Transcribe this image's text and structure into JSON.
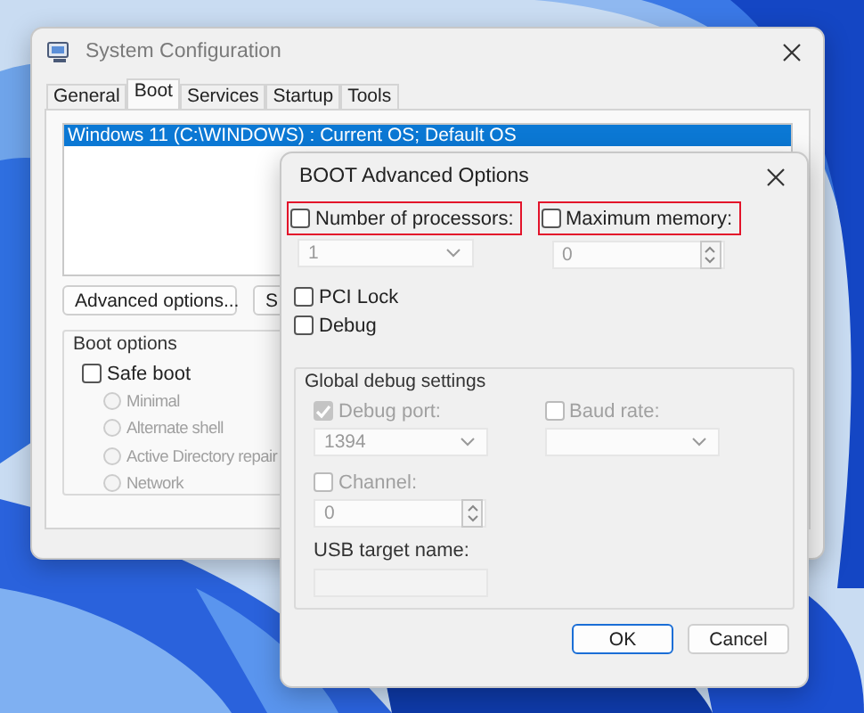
{
  "main_window": {
    "title": "System Configuration",
    "tabs": [
      {
        "label": "General",
        "selected": false
      },
      {
        "label": "Boot",
        "selected": true
      },
      {
        "label": "Services",
        "selected": false
      },
      {
        "label": "Startup",
        "selected": false
      },
      {
        "label": "Tools",
        "selected": false
      }
    ],
    "boot_list": [
      {
        "text": "Windows 11 (C:\\WINDOWS) : Current OS; Default OS",
        "selected": true
      }
    ],
    "buttons": [
      "Advanced options...",
      "S"
    ],
    "boot_options": {
      "title": "Boot options",
      "safe_boot": {
        "label": "Safe boot",
        "checked": false
      },
      "modes": [
        {
          "label": "Minimal",
          "selected": false,
          "disabled": true
        },
        {
          "label": "Alternate shell",
          "selected": false,
          "disabled": true
        },
        {
          "label": "Active Directory repair",
          "selected": false,
          "disabled": true
        },
        {
          "label": "Network",
          "selected": false,
          "disabled": true
        }
      ]
    }
  },
  "dialog": {
    "title": "BOOT Advanced Options",
    "processors": {
      "label": "Number of processors:",
      "checked": false,
      "highlighted": true,
      "value": "1",
      "disabled": true
    },
    "memory": {
      "label": "Maximum memory:",
      "checked": false,
      "highlighted": true,
      "value": "0",
      "disabled": true
    },
    "options": [
      {
        "label": "PCI Lock",
        "checked": false
      },
      {
        "label": "Debug",
        "checked": false
      }
    ],
    "debug_group": {
      "title": "Global debug settings",
      "debug_port": {
        "label": "Debug port:",
        "checked": true,
        "disabled": true,
        "value": "1394"
      },
      "baud_rate": {
        "label": "Baud rate:",
        "checked": false,
        "disabled": true
      },
      "channel": {
        "label": "Channel:",
        "checked": false,
        "disabled": true,
        "value": "0"
      },
      "usb_target": {
        "label": "USB target name:",
        "disabled": true
      }
    },
    "buttons": [
      {
        "label": "OK",
        "default": true
      },
      {
        "label": "Cancel",
        "default": false
      }
    ]
  }
}
